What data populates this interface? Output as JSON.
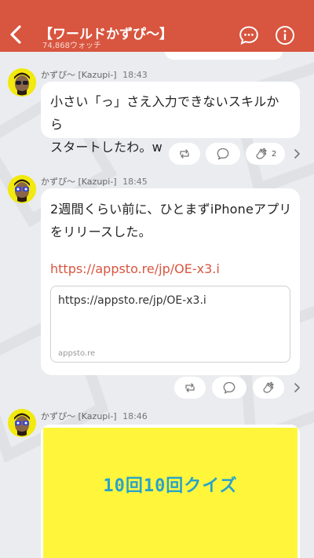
{
  "header": {
    "title": "【ワールドかずぴ〜】",
    "watchers": "74,868ウォッチ",
    "back_icon": "chevron-left-icon",
    "chat_icon": "chat-bubble-icon",
    "info_icon": "info-icon"
  },
  "messages": [
    {
      "author": "かずぴ〜 [Kazupi-]",
      "time": "18:43",
      "text": "小さい「っ」さえ入力できないスキルから\nスタートしたわ。w",
      "reactions": {
        "repost_icon": "repost-icon",
        "comment_icon": "comment-icon",
        "clap_icon": "clap-icon",
        "clap_count": "2"
      }
    },
    {
      "author": "かずぴ〜 [Kazupi-]",
      "time": "18:45",
      "text": "2週間くらい前に、ひとまずiPhoneアプリ\nをリリースした。",
      "link": "https://appsto.re/jp/OE-x3.i",
      "link_card": {
        "url": "https://appsto.re/jp/OE-x3.i",
        "domain": "appsto.re"
      },
      "reactions": {
        "repost_icon": "repost-icon",
        "comment_icon": "comment-icon",
        "clap_icon": "clap-icon"
      }
    },
    {
      "author": "かずぴ〜 [Kazupi-]",
      "time": "18:46",
      "image_text": "10回10回クイズ"
    }
  ],
  "colors": {
    "accent": "#d8553f",
    "background": "#eaecef",
    "image_bg": "#fff63b"
  }
}
